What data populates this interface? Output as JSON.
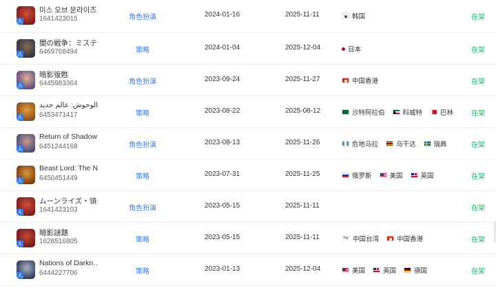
{
  "rows": [
    {
      "name": "미스 오브 문라이즈",
      "app_id": "1641423015",
      "category": "角色扮演",
      "release_date": "2024-01-16",
      "update_date": "2025-11-11",
      "icon_colors": [
        "#7a1a1a",
        "#d2513a"
      ],
      "regions": [
        {
          "flag": "kr",
          "label": "韩国"
        }
      ],
      "status": "在架"
    },
    {
      "name": "闇の戦争：ミステ…",
      "app_id": "6469768494",
      "category": "策略",
      "release_date": "2024-01-04",
      "update_date": "2025-12-04",
      "icon_colors": [
        "#2e3240",
        "#8a6a58"
      ],
      "regions": [
        {
          "flag": "jp",
          "label": "日本"
        }
      ],
      "status": "在架"
    },
    {
      "name": "暗影復甦",
      "app_id": "6445983364",
      "category": "角色扮演",
      "release_date": "2023-09-24",
      "update_date": "2025-11-27",
      "icon_colors": [
        "#5a4a8a",
        "#e0b08a"
      ],
      "regions": [
        {
          "flag": "hk",
          "label": "中国香港"
        }
      ],
      "status": "在架"
    },
    {
      "name": "سيد الوحوش: عالم جديد",
      "app_id": "6453471417",
      "category": "策略",
      "release_date": "2023-08-22",
      "update_date": "2025-08-12",
      "icon_colors": [
        "#8a4a1a",
        "#e0a040"
      ],
      "regions": [
        {
          "flag": "sa",
          "label": "沙特阿拉伯"
        },
        {
          "flag": "kw",
          "label": "科威特"
        },
        {
          "flag": "bh",
          "label": "巴林"
        }
      ],
      "status": "在架"
    },
    {
      "name": "Return of Shadow",
      "app_id": "6451244168",
      "category": "角色扮演",
      "release_date": "2023-08-13",
      "update_date": "2025-11-26",
      "icon_colors": [
        "#4a4a7a",
        "#c89a8a"
      ],
      "regions": [
        {
          "flag": "gt",
          "label": "危地马拉"
        },
        {
          "flag": "ug",
          "label": "乌干达"
        },
        {
          "flag": "se",
          "label": "瑞典"
        }
      ],
      "status": "在架"
    },
    {
      "name": "Beast Lord: The N…",
      "app_id": "6450451449",
      "category": "策略",
      "release_date": "2023-07-31",
      "update_date": "2025-11-25",
      "icon_colors": [
        "#7a3a10",
        "#d89a3a"
      ],
      "regions": [
        {
          "flag": "ru",
          "label": "俄罗斯"
        },
        {
          "flag": "us",
          "label": "美国"
        },
        {
          "flag": "gb",
          "label": "英国"
        }
      ],
      "status": "在架"
    },
    {
      "name": "ムーンライズ・領…",
      "app_id": "1641423103",
      "category": "角色扮演",
      "release_date": "2023-05-15",
      "update_date": "2025-11-11",
      "icon_colors": [
        "#7a1a1a",
        "#d2513a"
      ],
      "regions": [],
      "status": "在架"
    },
    {
      "name": "暗影謎題",
      "app_id": "1628516805",
      "category": "策略",
      "release_date": "2023-05-15",
      "update_date": "2025-11-11",
      "icon_colors": [
        "#6a1a1a",
        "#c84a3a"
      ],
      "regions": [
        {
          "flag": "tw",
          "label": "中国台湾",
          "badge": "TW"
        },
        {
          "flag": "hk",
          "label": "中国香港"
        }
      ],
      "status": "在架"
    },
    {
      "name": "Nations of Darkn…",
      "app_id": "6444227706",
      "category": "策略",
      "release_date": "2023-01-13",
      "update_date": "2025-12-04",
      "icon_colors": [
        "#2a3a5a",
        "#a8b0c0"
      ],
      "regions": [
        {
          "flag": "us",
          "label": "美国"
        },
        {
          "flag": "gb",
          "label": "英国"
        },
        {
          "flag": "de",
          "label": "德国"
        }
      ],
      "status": "在架"
    }
  ],
  "badge_glyph": "人",
  "colors": {
    "category": "#3b7ddd",
    "status": "#19b46a",
    "badge": "#2f7bf2"
  }
}
